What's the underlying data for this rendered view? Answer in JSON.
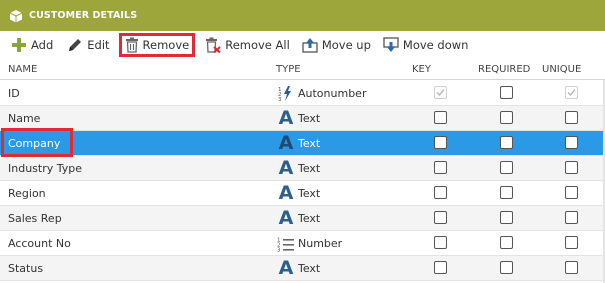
{
  "panel": {
    "title": "CUSTOMER DETAILS"
  },
  "toolbar": {
    "add": "Add",
    "edit": "Edit",
    "remove": "Remove",
    "remove_all": "Remove All",
    "move_up": "Move up",
    "move_down": "Move down"
  },
  "columns": {
    "name": "NAME",
    "type": "TYPE",
    "key": "KEY",
    "required": "REQUIRED",
    "unique": "UNIQUE"
  },
  "rows": [
    {
      "name": "ID",
      "type": "Autonumber",
      "type_icon": "autonumber-icon",
      "key": true,
      "required": false,
      "unique": true,
      "locked": true
    },
    {
      "name": "Name",
      "type": "Text",
      "type_icon": "text-type-icon",
      "key": false,
      "required": false,
      "unique": false
    },
    {
      "name": "Company",
      "type": "Text",
      "type_icon": "text-type-icon",
      "key": false,
      "required": false,
      "unique": false,
      "selected": true
    },
    {
      "name": "Industry Type",
      "type": "Text",
      "type_icon": "text-type-icon",
      "key": false,
      "required": false,
      "unique": false
    },
    {
      "name": "Region",
      "type": "Text",
      "type_icon": "text-type-icon",
      "key": false,
      "required": false,
      "unique": false
    },
    {
      "name": "Sales Rep",
      "type": "Text",
      "type_icon": "text-type-icon",
      "key": false,
      "required": false,
      "unique": false
    },
    {
      "name": "Account No",
      "type": "Number",
      "type_icon": "number-list-icon",
      "key": false,
      "required": false,
      "unique": false
    },
    {
      "name": "Status",
      "type": "Text",
      "type_icon": "text-type-icon",
      "key": false,
      "required": false,
      "unique": false
    }
  ],
  "colors": {
    "titlebar": "#9da63a",
    "selection": "#2b99e6",
    "highlight": "#e02a35"
  }
}
